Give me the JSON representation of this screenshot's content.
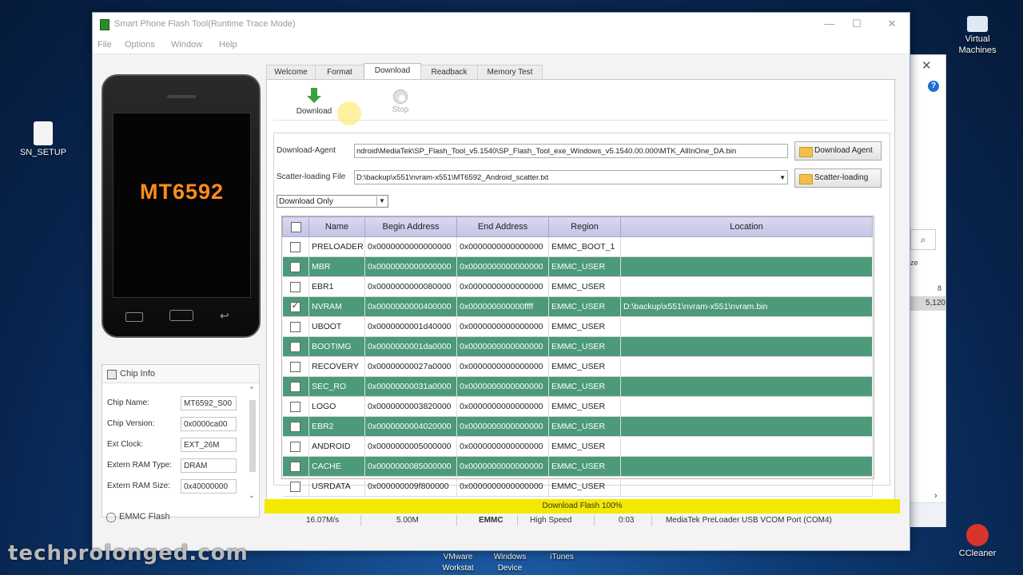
{
  "window": {
    "title": "Smart Phone Flash Tool(Runtime Trace Mode)",
    "controls": [
      "—",
      "☐",
      "✕"
    ]
  },
  "menu": [
    "File",
    "Options",
    "Window",
    "Help"
  ],
  "phone": {
    "chip_label": "MT6592"
  },
  "chip_info": {
    "title": "Chip Info",
    "rows": [
      {
        "label": "Chip Name:",
        "value": "MT6592_S00"
      },
      {
        "label": "Chip Version:",
        "value": "0x0000ca00"
      },
      {
        "label": "Ext Clock:",
        "value": "EXT_26M"
      },
      {
        "label": "Extern RAM Type:",
        "value": "DRAM"
      },
      {
        "label": "Extern RAM Size:",
        "value": "0x40000000"
      }
    ],
    "footer": "EMMC Flash"
  },
  "tabs": [
    "Welcome",
    "Format",
    "Download",
    "Readback",
    "Memory Test"
  ],
  "toolbar": {
    "download_label": "Download",
    "stop_label": "Stop"
  },
  "download_agent": {
    "label": "Download-Agent",
    "path": "ndroid\\MediaTek\\SP_Flash_Tool_v5.1540\\SP_Flash_Tool_exe_Windows_v5.1540.00.000\\MTK_AllInOne_DA.bin",
    "button": "Download Agent"
  },
  "scatter": {
    "label": "Scatter-loading File",
    "path": "D:\\backup\\x551\\nvram-x551\\MT6592_Android_scatter.txt",
    "button": "Scatter-loading"
  },
  "mode_select": {
    "value": "Download Only"
  },
  "table": {
    "headers": [
      "",
      "Name",
      "Begin Address",
      "End Address",
      "Region",
      "Location"
    ],
    "rows": [
      {
        "name": "PRELOADER",
        "begin": "0x0000000000000000",
        "end": "0x0000000000000000",
        "region": "EMMC_BOOT_1",
        "location": "",
        "checked": false,
        "selected": false
      },
      {
        "name": "MBR",
        "begin": "0x0000000000000000",
        "end": "0x0000000000000000",
        "region": "EMMC_USER",
        "location": "",
        "checked": false,
        "selected": true
      },
      {
        "name": "EBR1",
        "begin": "0x0000000000080000",
        "end": "0x0000000000000000",
        "region": "EMMC_USER",
        "location": "",
        "checked": false,
        "selected": false
      },
      {
        "name": "NVRAM",
        "begin": "0x0000000000400000",
        "end": "0x000000000000ffff",
        "region": "EMMC_USER",
        "location": "D:\\backup\\x551\\nvram-x551\\nvram.bin",
        "checked": true,
        "selected": true
      },
      {
        "name": "UBOOT",
        "begin": "0x0000000001d40000",
        "end": "0x0000000000000000",
        "region": "EMMC_USER",
        "location": "",
        "checked": false,
        "selected": false
      },
      {
        "name": "BOOTIMG",
        "begin": "0x0000000001da0000",
        "end": "0x0000000000000000",
        "region": "EMMC_USER",
        "location": "",
        "checked": false,
        "selected": true
      },
      {
        "name": "RECOVERY",
        "begin": "0x00000000027a0000",
        "end": "0x0000000000000000",
        "region": "EMMC_USER",
        "location": "",
        "checked": false,
        "selected": false
      },
      {
        "name": "SEC_RO",
        "begin": "0x00000000031a0000",
        "end": "0x0000000000000000",
        "region": "EMMC_USER",
        "location": "",
        "checked": false,
        "selected": true
      },
      {
        "name": "LOGO",
        "begin": "0x0000000003820000",
        "end": "0x0000000000000000",
        "region": "EMMC_USER",
        "location": "",
        "checked": false,
        "selected": false
      },
      {
        "name": "EBR2",
        "begin": "0x0000000004020000",
        "end": "0x0000000000000000",
        "region": "EMMC_USER",
        "location": "",
        "checked": false,
        "selected": true
      },
      {
        "name": "ANDROID",
        "begin": "0x0000000005000000",
        "end": "0x0000000000000000",
        "region": "EMMC_USER",
        "location": "",
        "checked": false,
        "selected": false
      },
      {
        "name": "CACHE",
        "begin": "0x0000000085000000",
        "end": "0x0000000000000000",
        "region": "EMMC_USER",
        "location": "",
        "checked": false,
        "selected": true
      },
      {
        "name": "USRDATA",
        "begin": "0x000000009f800000",
        "end": "0x0000000000000000",
        "region": "EMMC_USER",
        "location": "",
        "checked": false,
        "selected": false
      }
    ]
  },
  "progress": {
    "text": "Download Flash 100%",
    "percent": 100,
    "color": "#f5e800"
  },
  "status": {
    "speed": "16.07M/s",
    "size": "5.00M",
    "storage": "EMMC",
    "usb_speed": "High Speed",
    "time": "0:03",
    "port": "MediaTek PreLoader USB VCOM Port (COM4)"
  },
  "desktop": {
    "icons": [
      {
        "label": "SN_SETUP"
      },
      {
        "label": "Virtual Machines"
      },
      {
        "label": "CCleaner"
      }
    ],
    "taskbar_labels": [
      "VMware Workstat",
      "Windows Device",
      "iTunes"
    ]
  },
  "bg_window": {
    "size_partial": "ze",
    "value_partial": "8",
    "row_value": "5,120"
  },
  "watermark": "techprolonged.com",
  "colors": {
    "selected_row": "#4c9a79",
    "header": "#c3c3e6",
    "accent_orange": "#ff8c1a"
  }
}
